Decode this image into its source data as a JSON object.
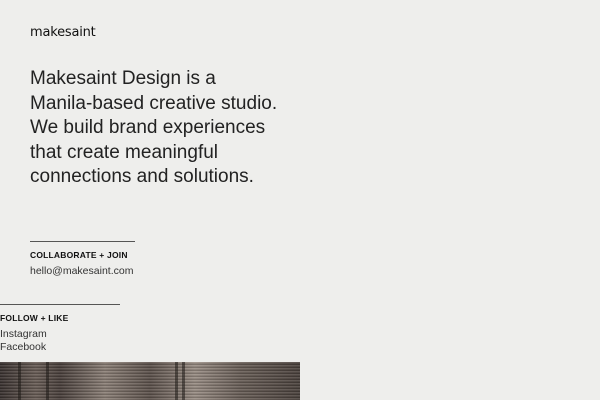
{
  "brand": {
    "logo_text": "makesaint"
  },
  "intro": {
    "text": "Makesaint Design is a Manila-based creative studio. We build brand experiences that create meaningful connections and solutions."
  },
  "collaborate": {
    "heading": "COLLABORATE + JOIN",
    "email": "hello@makesaint.com"
  },
  "follow": {
    "heading": "FOLLOW + LIKE",
    "links": [
      "Instagram",
      "Facebook"
    ]
  },
  "colors": {
    "background": "#eeeeec",
    "text": "#1a1a1a"
  }
}
